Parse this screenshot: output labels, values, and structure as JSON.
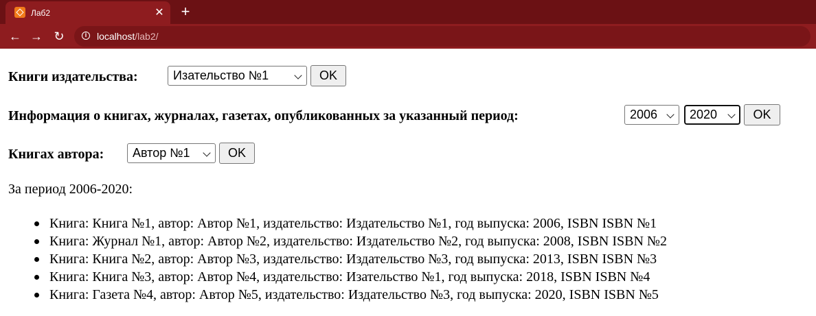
{
  "browser": {
    "tab_title": "Лаб2",
    "tab_close": "✕",
    "new_tab": "+",
    "url_host": "localhost",
    "url_path": "/lab2/",
    "back": "←",
    "forward": "→",
    "reload": "↻",
    "info": "i"
  },
  "colors": {
    "tabbar": "#6b1114",
    "toolbar": "#8e1c1f"
  },
  "forms": {
    "publisher": {
      "label": "Книги издательства:",
      "selected": "Изательство №1",
      "ok": "OK"
    },
    "period": {
      "label": "Информация о книгах, журналах, газетах, опубликованных за указанный период:",
      "from": "2006",
      "to": "2020",
      "ok": "OK"
    },
    "author": {
      "label": "Книгах автора:",
      "selected": "Автор №1",
      "ok": "OK"
    }
  },
  "result": {
    "heading": "За период 2006-2020:",
    "items": [
      "Книга: Книга №1, автор: Автор №1, издательство: Издательство №1, год выпуска: 2006, ISBN ISBN №1",
      "Книга: Журнал №1, автор: Автор №2, издательство: Издательство №2, год выпуска: 2008, ISBN ISBN №2",
      "Книга: Книга №2, автор: Автор №3, издательство: Издательство №3, год выпуска: 2013, ISBN ISBN №3",
      "Книга: Книга №3, автор: Автор №4, издательство: Изательство №1, год выпуска: 2018, ISBN ISBN №4",
      "Книга: Газета №4, автор: Автор №5, издательство: Издательство №3, год выпуска: 2020, ISBN ISBN №5"
    ]
  }
}
